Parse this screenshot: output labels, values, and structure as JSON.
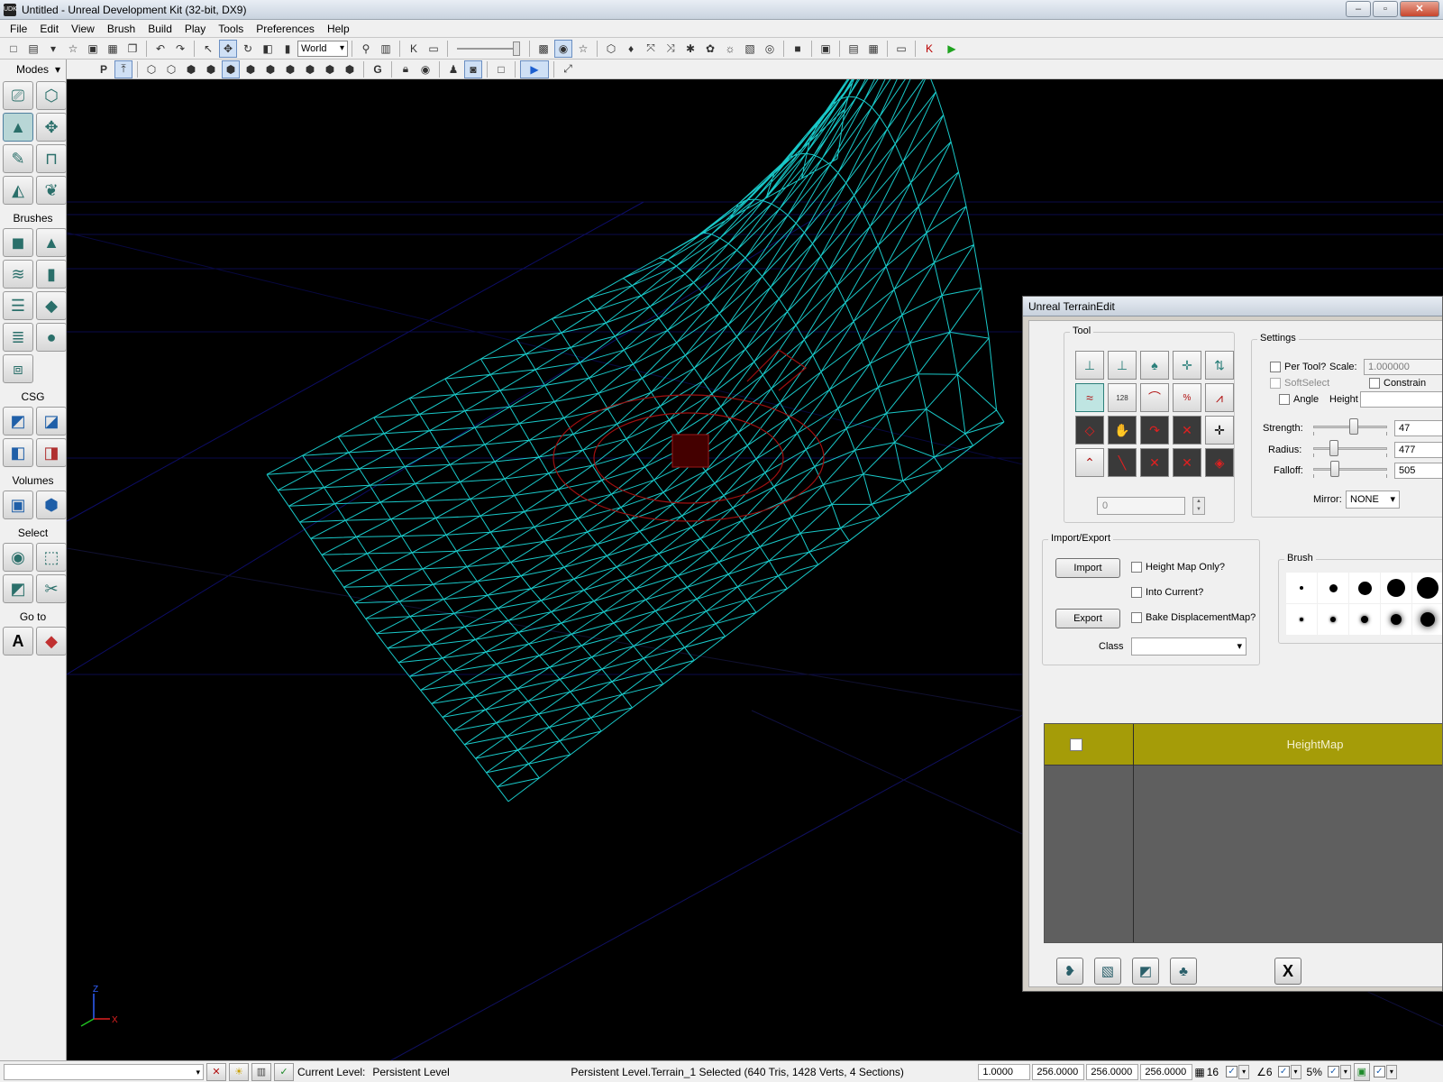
{
  "window": {
    "title": "Untitled - Unreal Development Kit (32-bit, DX9)",
    "icon_text": "UDK",
    "buttons": [
      "–",
      "▫",
      "✕"
    ]
  },
  "menubar": [
    "File",
    "Edit",
    "View",
    "Brush",
    "Build",
    "Play",
    "Tools",
    "Preferences",
    "Help"
  ],
  "toolbar": {
    "coordinate_system": "World"
  },
  "viewport_toolbar": {
    "labels": [
      "P",
      "G"
    ]
  },
  "modes_panel": {
    "title": "Modes",
    "sections": {
      "brushes": "Brushes",
      "csg": "CSG",
      "volumes": "Volumes",
      "select": "Select",
      "goto": "Go to"
    }
  },
  "viewport": {
    "axis_labels": [
      "Z",
      "X"
    ]
  },
  "terrain_edit": {
    "title": "Unreal TerrainEdit",
    "tool_group": {
      "title": "Tool",
      "value": "0",
      "tool_labels": [
        "128",
        "%"
      ]
    },
    "settings": {
      "title": "Settings",
      "per_tool_label": "Per Tool?",
      "scale_label": "Scale:",
      "scale_value": "1.000000",
      "soft_select_label": "SoftSelect",
      "constrain_label": "Constrain",
      "angle_label": "Angle",
      "height_label": "Height",
      "strength_label": "Strength:",
      "strength_value": "47",
      "strength_level": 0.55,
      "radius_label": "Radius:",
      "radius_value": "477",
      "radius_level": 0.25,
      "falloff_label": "Falloff:",
      "falloff_value": "505",
      "falloff_level": 0.27,
      "mirror_label": "Mirror:",
      "mirror_value": "NONE"
    },
    "import_export": {
      "title": "Import/Export",
      "import_label": "Import",
      "export_label": "Export",
      "heightmap_only_label": "Height Map Only?",
      "into_current_label": "Into Current?",
      "bake_displacement_label": "Bake DisplacementMap?",
      "class_label": "Class",
      "class_value": ""
    },
    "brush": {
      "title": "Brush"
    },
    "layers": {
      "header": "HeightMap"
    },
    "close_label": "X"
  },
  "statusbar": {
    "current_level_label": "Current Level:",
    "current_level_value": "Persistent Level",
    "selection_info": "Persistent Level.Terrain_1 Selected (640 Tris, 1428 Verts, 4 Sections)",
    "drag_grid": "1.0000",
    "scale_x": "256.0000",
    "scale_y": "256.0000",
    "scale_z": "256.0000",
    "grid_size": "16",
    "rotation_snap": "6",
    "scale_snap": "5%"
  }
}
